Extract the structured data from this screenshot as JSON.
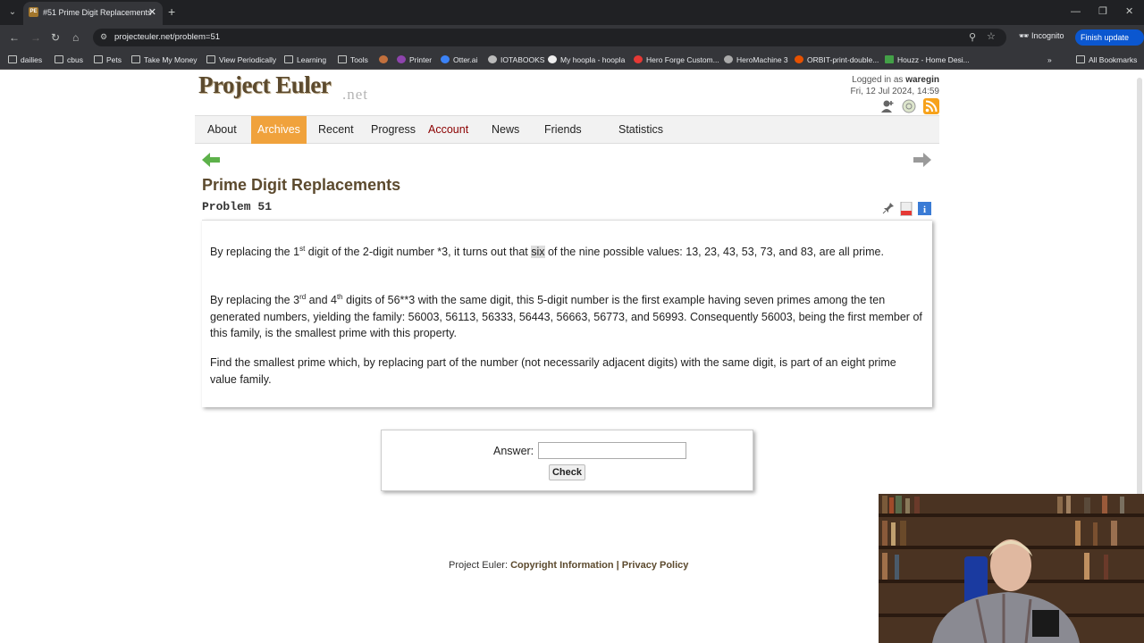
{
  "browser": {
    "tab_title": "#51 Prime Digit Replacements",
    "url": "projecteuler.net/problem=51",
    "incognito_label": "Incognito",
    "finish_update_label": "Finish update",
    "bookmarks": [
      "dailies",
      "cbus",
      "Pets",
      "Take My Money",
      "View Periodically",
      "Learning",
      "Tools",
      "",
      "Printer",
      "Otter.ai",
      "IOTABOOKS",
      "My hoopla - hoopla",
      "Hero Forge Custom...",
      "HeroMachine 3",
      "ORBIT-print-double...",
      "Houzz - Home Desi..."
    ],
    "all_bookmarks": "All Bookmarks"
  },
  "site": {
    "logo": "Project Euler",
    "logo_suffix": ".net",
    "logged_in_prefix": "Logged in as",
    "username": "waregin",
    "datetime": "Fri, 12 Jul 2024, 14:59"
  },
  "nav": [
    "About",
    "Archives",
    "Recent",
    "Progress",
    "Account",
    "News",
    "Friends",
    "Statistics"
  ],
  "problem": {
    "title": "Prime Digit Replacements",
    "number": "Problem 51",
    "p1a": "By replacing the 1",
    "p1sup": "st",
    "p1b": " digit of the 2-digit number *3, it turns out that ",
    "p1hl": "six",
    "p1c": " of the nine possible values: 13, 23, 43, 53, 73, and 83, are all prime.",
    "p2a": "By replacing the 3",
    "p2sup1": "rd",
    "p2b": " and 4",
    "p2sup2": "th",
    "p2c": " digits of 56**3 with the same digit, this 5-digit number is the first example having seven primes among the ten generated numbers, yielding the family: 56003, 56113, 56333, 56443, 56663, 56773, and 56993. Consequently 56003, being the first member of this family, is the smallest prime with this property.",
    "p3": "Find the smallest prime which, by replacing part of the number (not necessarily adjacent digits) with the same digit, is part of an eight prime value family."
  },
  "answer": {
    "label": "Answer:",
    "value": "",
    "check_label": "Check"
  },
  "footer": {
    "prefix": "Project Euler: ",
    "copyright": "Copyright Information",
    "sep": " | ",
    "privacy": "Privacy Policy"
  },
  "colors": {
    "accent": "#f0a23c",
    "brand_brown": "#5c4a2e",
    "account_red": "#8b0000"
  }
}
